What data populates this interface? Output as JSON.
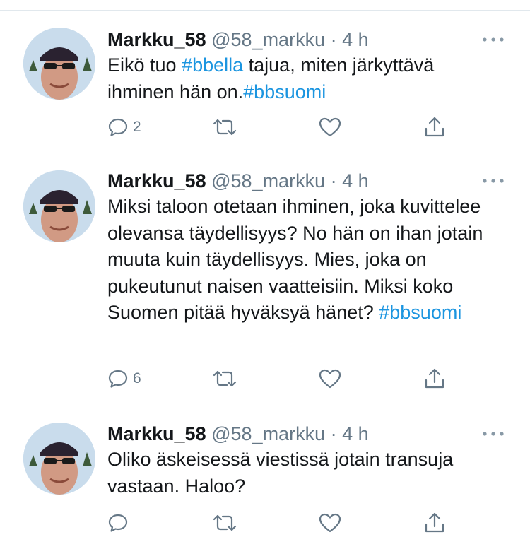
{
  "tweets": [
    {
      "name": "Markku_58",
      "handle": "@58_markku",
      "separator": "·",
      "time": "4 h",
      "body": [
        {
          "text": "Eikö tuo ",
          "tag": false
        },
        {
          "text": "#bbella",
          "tag": true
        },
        {
          "text": " tajua, miten järkyttävä ihminen hän on.",
          "tag": false
        },
        {
          "text": "#bbsuomi",
          "tag": true
        }
      ],
      "reply_count": "2"
    },
    {
      "name": "Markku_58",
      "handle": "@58_markku",
      "separator": "·",
      "time": "4 h",
      "body": [
        {
          "text": "Miksi taloon otetaan ihminen, joka kuvittelee olevansa täydellisyys? No hän on ihan jotain muuta kuin täydellisyys. Mies, joka on pukeutunut naisen vaatteisiin. Miksi koko Suomen pitää hyväksyä hänet? ",
          "tag": false
        },
        {
          "text": "#bbsuomi",
          "tag": true
        }
      ],
      "reply_count": "6"
    },
    {
      "name": "Markku_58",
      "handle": "@58_markku",
      "separator": "·",
      "time": "4 h",
      "body": [
        {
          "text": "Oliko äskeisessä viestissä jotain transuja vastaan. Haloo?",
          "tag": false
        }
      ],
      "reply_count": ""
    }
  ],
  "icons": {
    "reply": "reply-icon",
    "retweet": "retweet-icon",
    "like": "like-icon",
    "share": "share-icon",
    "more": "more-icon"
  },
  "colors": {
    "text": "#14171a",
    "secondary": "#657786",
    "hashtag": "#1b95e0",
    "divider": "#e1e8ed"
  }
}
